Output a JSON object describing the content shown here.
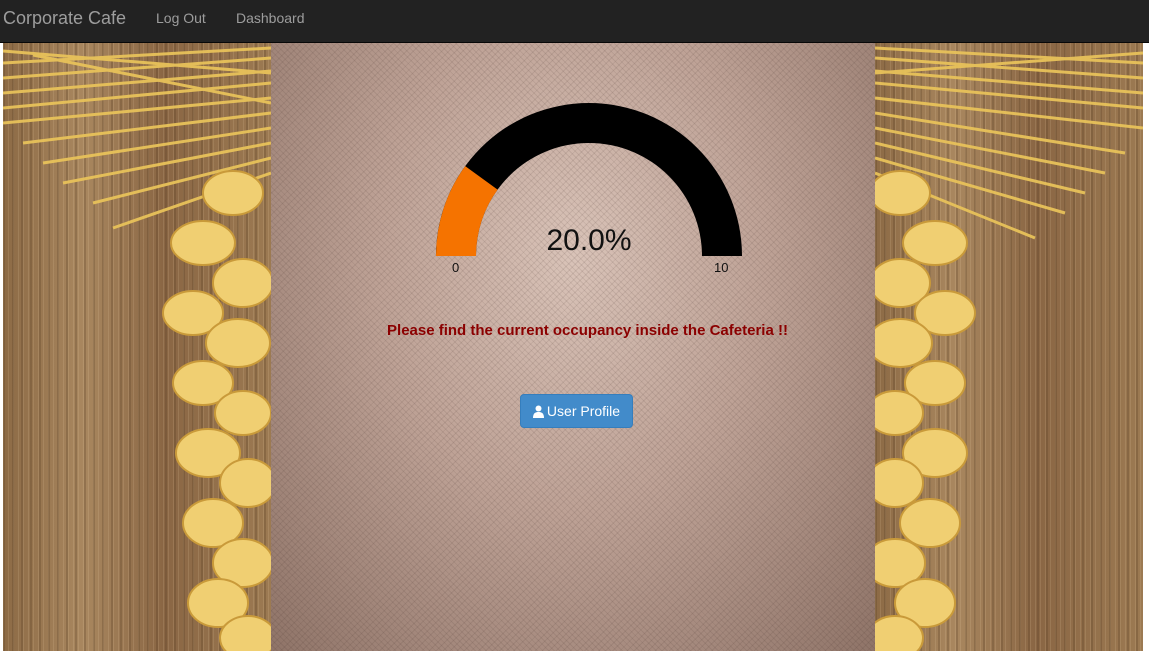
{
  "navbar": {
    "brand": "Corporate Cafe",
    "links": [
      {
        "label": "Log Out"
      },
      {
        "label": "Dashboard"
      }
    ]
  },
  "gauge": {
    "value_text": "20.0%",
    "value_fraction": 0.2,
    "min_label": "0",
    "max_label": "10",
    "fill_color": "#f57300",
    "track_color": "#000000"
  },
  "message": "Please find the current occupancy inside the Cafeteria !!",
  "buttons": {
    "user_profile": {
      "label": "User Profile",
      "icon": "user-icon",
      "color": "#428bca"
    }
  },
  "colors": {
    "navbar_bg": "#222222",
    "navbar_text": "#9d9d9d",
    "message_text": "#8b0000"
  }
}
